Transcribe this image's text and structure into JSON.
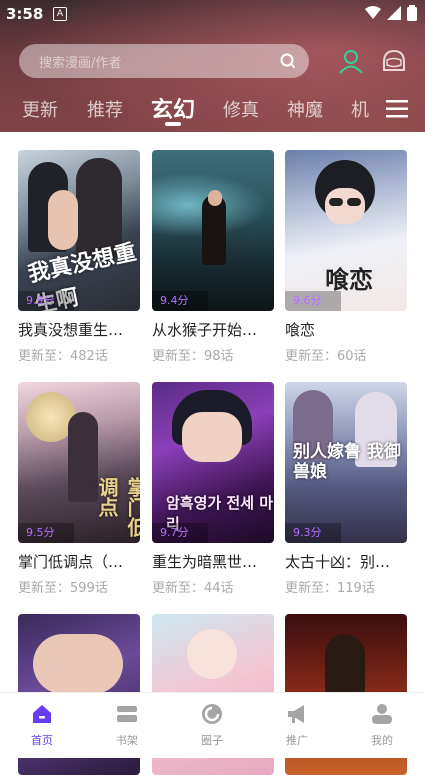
{
  "status": {
    "time": "3:58",
    "app_badge": "A"
  },
  "search": {
    "placeholder": "搜索漫画/作者"
  },
  "tabs": [
    {
      "label": "更新",
      "active": false
    },
    {
      "label": "推荐",
      "active": false
    },
    {
      "label": "玄幻",
      "active": true
    },
    {
      "label": "修真",
      "active": false
    },
    {
      "label": "神魔",
      "active": false
    },
    {
      "label": "机",
      "active": false
    }
  ],
  "cards": [
    {
      "title": "我真没想重生…",
      "update": "更新至：482话",
      "score": "9.9分",
      "cover_text": "我真没想重生啊"
    },
    {
      "title": "从水猴子开始…",
      "update": "更新至：98话",
      "score": "9.4分",
      "cover_text": ""
    },
    {
      "title": "喰恋",
      "update": "更新至：60话",
      "score": "9.6分",
      "cover_text": "喰恋"
    },
    {
      "title": "掌门低调点（…",
      "update": "更新至：599话",
      "score": "9.5分",
      "cover_text": "掌门低调点"
    },
    {
      "title": "重生为暗黑世…",
      "update": "更新至：44话",
      "score": "9.7分",
      "cover_text": "암흑영가 전세 마리"
    },
    {
      "title": "太古十凶：别…",
      "update": "更新至：119话",
      "score": "9.3分",
      "cover_text": "别人嫁鲁 我御兽娘"
    }
  ],
  "nav": [
    {
      "label": "首页",
      "icon": "home-icon",
      "active": true
    },
    {
      "label": "书架",
      "icon": "bookshelf-icon",
      "active": false
    },
    {
      "label": "圈子",
      "icon": "circle-icon",
      "active": false
    },
    {
      "label": "推广",
      "icon": "megaphone-icon",
      "active": false
    },
    {
      "label": "我的",
      "icon": "profile-icon",
      "active": false
    }
  ],
  "colors": {
    "accent": "#6a3cf0",
    "score": "#b46cff",
    "user_icon": "#2fd39a"
  }
}
